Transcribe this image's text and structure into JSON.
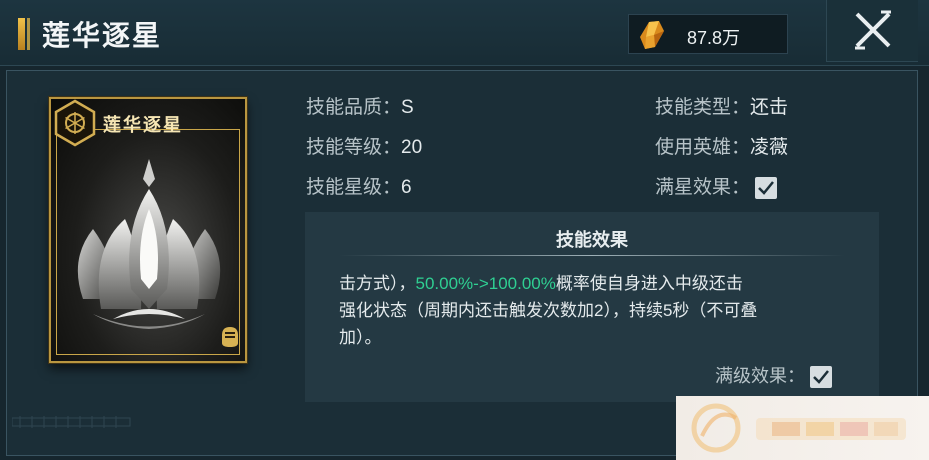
{
  "header": {
    "title": "莲华逐星",
    "currency_value": "87.8万",
    "currency_icon": "crystal-icon",
    "close_icon": "close-icon"
  },
  "card": {
    "title": "莲华逐星",
    "emblem_icon": "hexagon-emblem-icon",
    "art": "silver-lotus-art",
    "corner_icon": "hand-badge-icon"
  },
  "info": {
    "quality_label": "技能品质：",
    "quality_value": "S",
    "level_label": "技能等级：",
    "level_value": "20",
    "star_label": "技能星级：",
    "star_value": "6",
    "type_label": "技能类型：",
    "type_value": "还击",
    "hero_label": "使用英雄：",
    "hero_value": "凌薇",
    "fullstar_label": "满星效果：",
    "fullstar_checked": true
  },
  "effect": {
    "heading": "技能效果",
    "line1_prefix": "击方式），",
    "line1_highlight": "50.00%->100.00%",
    "line1_suffix": "概率使自身进入中级还击",
    "line2": "强化状态（周期内还击触发次数加2），持续5秒（不可叠",
    "line3": "加）。",
    "maxlevel_label": "满级效果：",
    "maxlevel_checked": true
  },
  "colors": {
    "accent_gold": "#f0c24a",
    "highlight_green": "#2fcf92",
    "panel_bg": "#1b2e37"
  }
}
